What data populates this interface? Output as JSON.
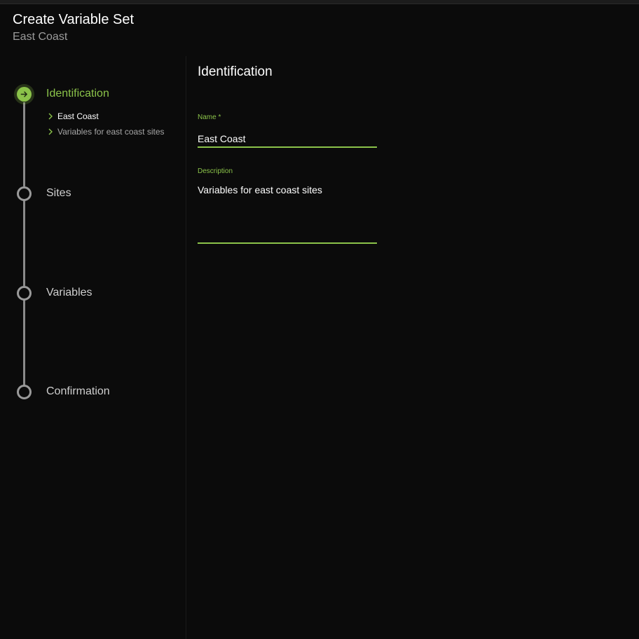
{
  "header": {
    "title": "Create Variable Set",
    "subtitle": "East Coast"
  },
  "stepper": {
    "steps": [
      {
        "label": "Identification",
        "state": "active"
      },
      {
        "label": "Sites",
        "state": "idle"
      },
      {
        "label": "Variables",
        "state": "idle"
      },
      {
        "label": "Confirmation",
        "state": "idle"
      }
    ],
    "summary": [
      "East Coast",
      "Variables for east coast sites"
    ]
  },
  "form": {
    "section_title": "Identification",
    "name_label": "Name *",
    "name_value": "East Coast",
    "description_label": "Description",
    "description_value": "Variables for east coast sites"
  },
  "colors": {
    "accent": "#8bc34a",
    "background": "#0b0b0b",
    "rail": "#8a8a8a"
  },
  "icons": {
    "active_step": "arrow-right-icon",
    "summary_bullet": "chevron-right-icon"
  }
}
